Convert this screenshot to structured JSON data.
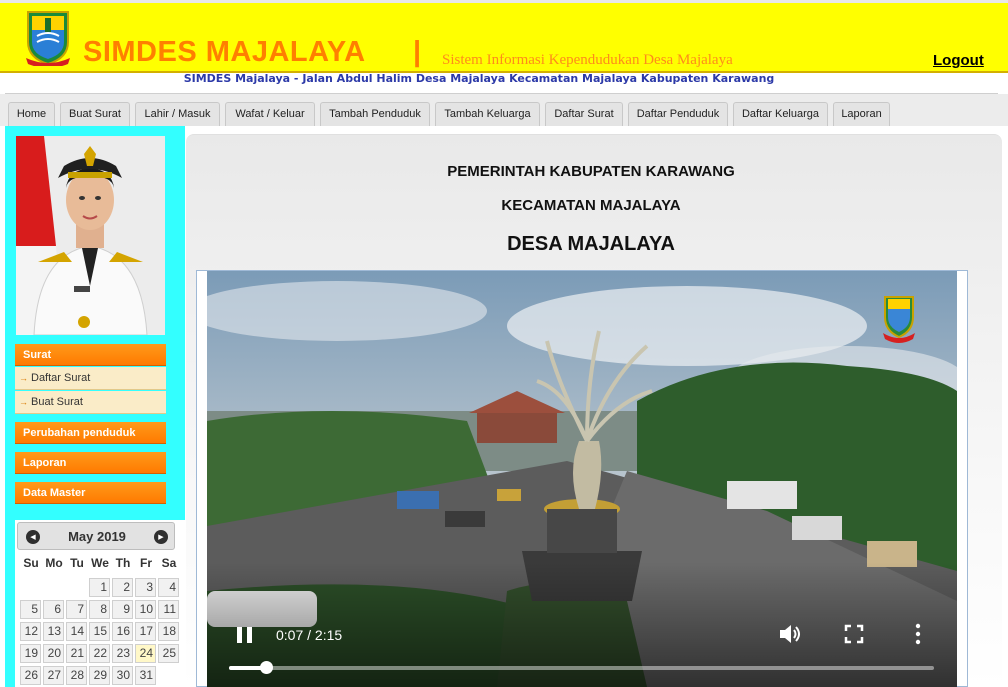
{
  "header": {
    "app_title": "SIMDES MAJALAYA",
    "separator": "|",
    "subtitle": "Sistem Informasi Kependudukan Desa Majalaya",
    "logout_label": "Logout",
    "address": "SIMDES Majalaya - Jalan Abdul Halim Desa Majalaya Kecamatan Majalaya Kabupaten Karawang",
    "colors": {
      "background": "#ffff00",
      "title": "#ff7f00",
      "address": "#2d3aa8"
    }
  },
  "tabs": [
    {
      "label": "Home"
    },
    {
      "label": "Buat Surat"
    },
    {
      "label": "Lahir / Masuk"
    },
    {
      "label": "Wafat / Keluar"
    },
    {
      "label": "Tambah Penduduk"
    },
    {
      "label": "Tambah Keluarga"
    },
    {
      "label": "Daftar Surat"
    },
    {
      "label": "Daftar Penduduk"
    },
    {
      "label": "Daftar Keluarga"
    },
    {
      "label": "Laporan"
    }
  ],
  "sidebar": {
    "menu": [
      {
        "label": "Surat",
        "children": [
          {
            "label": "Daftar Surat"
          },
          {
            "label": "Buat Surat"
          }
        ]
      },
      {
        "label": "Perubahan penduduk"
      },
      {
        "label": "Laporan"
      },
      {
        "label": "Data Master"
      }
    ],
    "calendar": {
      "title": "May 2019",
      "prev_icon": "◀",
      "next_icon": "▶",
      "weekdays": [
        "Su",
        "Mo",
        "Tu",
        "We",
        "Th",
        "Fr",
        "Sa"
      ],
      "weeks": [
        [
          "",
          "",
          "",
          "1",
          "2",
          "3",
          "4"
        ],
        [
          "5",
          "6",
          "7",
          "8",
          "9",
          "10",
          "11"
        ],
        [
          "12",
          "13",
          "14",
          "15",
          "16",
          "17",
          "18"
        ],
        [
          "19",
          "20",
          "21",
          "22",
          "23",
          "24",
          "25"
        ],
        [
          "26",
          "27",
          "28",
          "29",
          "30",
          "31",
          ""
        ]
      ],
      "today": "24"
    },
    "colors": {
      "background": "#33ffff",
      "menu": "#ff8c00",
      "submenu": "#faecc8"
    }
  },
  "main": {
    "line1": "PEMERINTAH KABUPATEN KARAWANG",
    "line2": "KECAMATAN MAJALAYA",
    "line3": "DESA MAJALAYA"
  },
  "video": {
    "time": "0:07 / 2:15",
    "progress": 0.052,
    "icons": {
      "play_pause": "pause-icon",
      "volume": "volume-icon",
      "fullscreen": "fullscreen-icon",
      "more": "more-vert-icon"
    }
  }
}
